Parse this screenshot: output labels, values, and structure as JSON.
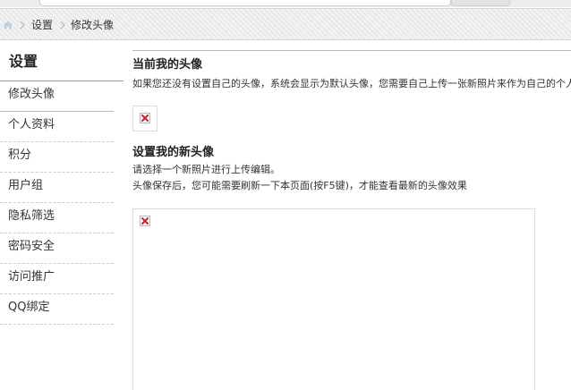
{
  "breadcrumb": {
    "items": [
      {
        "label": "设置"
      },
      {
        "label": "修改头像"
      }
    ]
  },
  "sidebar": {
    "title": "设置",
    "items": [
      {
        "label": "修改头像",
        "active": true
      },
      {
        "label": "个人资料"
      },
      {
        "label": "积分"
      },
      {
        "label": "用户组"
      },
      {
        "label": "隐私筛选"
      },
      {
        "label": "密码安全"
      },
      {
        "label": "访问推广"
      },
      {
        "label": "QQ绑定"
      }
    ]
  },
  "current_avatar": {
    "heading": "当前我的头像",
    "note": "如果您还没有设置自己的头像，系统会显示为默认头像，您需要自己上传一张新照片来作为自己的个人头像"
  },
  "new_avatar": {
    "heading": "设置我的新头像",
    "line1": "请选择一个新照片进行上传编辑。",
    "line2": "头像保存后，您可能需要刷新一下本页面(按F5键)，才能查看最新的头像效果"
  },
  "colors": {
    "broken_image_x": "#cc2222"
  },
  "icons": {
    "home": "home-icon",
    "separator": "chevron-right-icon",
    "broken_image": "broken-image-icon"
  }
}
